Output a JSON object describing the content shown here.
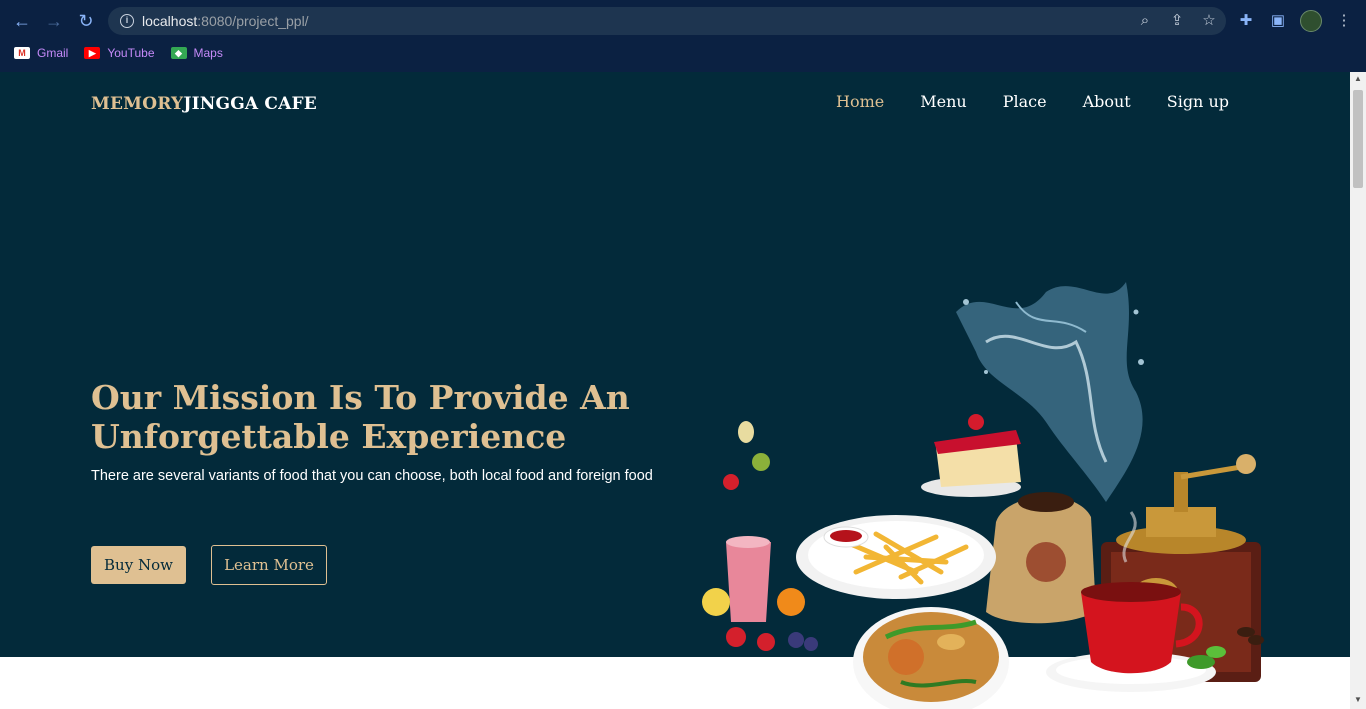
{
  "browser": {
    "url_host": "localhost",
    "url_path": ":8080/project_ppl/",
    "bookmarks": [
      {
        "label": "Gmail",
        "icon": "gmail-icon"
      },
      {
        "label": "YouTube",
        "icon": "youtube-icon"
      },
      {
        "label": "Maps",
        "icon": "maps-icon"
      }
    ]
  },
  "site": {
    "logo_part1": "MEMORY",
    "logo_part2": "JINGGA CAFE",
    "nav": [
      {
        "label": "Home",
        "active": true
      },
      {
        "label": "Menu",
        "active": false
      },
      {
        "label": "Place",
        "active": false
      },
      {
        "label": "About",
        "active": false
      },
      {
        "label": "Sign up",
        "active": false
      }
    ]
  },
  "hero": {
    "title": "Our Mission Is To Provide An Unforgettable Experience",
    "subtitle": "There are several variants of food that you can choose, both local food and foreign food",
    "buy_label": "Buy Now",
    "learn_label": "Learn More"
  },
  "colors": {
    "background": "#032a3a",
    "accent": "#dfc092",
    "chrome": "#0b2142"
  }
}
